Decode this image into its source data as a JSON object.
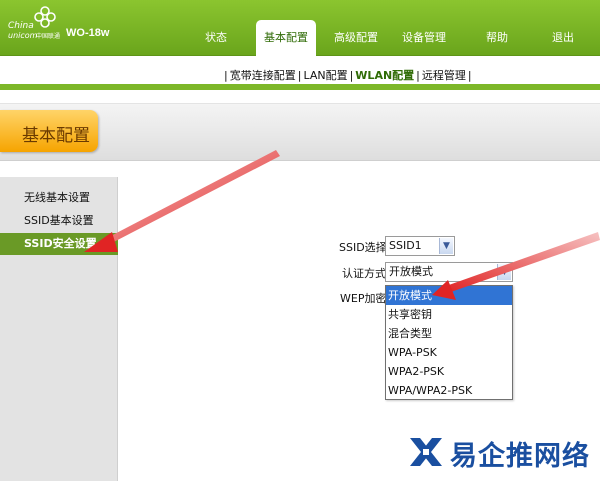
{
  "brand": {
    "logo_text_line1": "China",
    "logo_text_line2": "unicom",
    "logo_cn": "中国联通",
    "model": "WO-18w"
  },
  "nav": {
    "items": [
      {
        "label": "状态"
      },
      {
        "label": "基本配置",
        "active": true
      },
      {
        "label": "高级配置"
      },
      {
        "label": "设备管理"
      },
      {
        "label": "帮助"
      },
      {
        "label": "退出"
      }
    ]
  },
  "subnav": {
    "items": [
      "宽带连接配置",
      "LAN配置",
      "WLAN配置",
      "远程管理"
    ],
    "current": "WLAN配置"
  },
  "banner": {
    "title": "基本配置"
  },
  "sidebar": {
    "items": [
      {
        "label": "无线基本设置"
      },
      {
        "label": "SSID基本设置"
      },
      {
        "label": "SSID安全设置",
        "active": true
      }
    ]
  },
  "form": {
    "ssid_label": "SSID选择",
    "ssid_value": "SSID1",
    "auth_label": "认证方式",
    "auth_value": "开放模式",
    "wep_label": "WEP加密"
  },
  "dropdown": {
    "options": [
      "开放模式",
      "共享密钥",
      "混合类型",
      "WPA-PSK",
      "WPA2-PSK",
      "WPA/WPA2-PSK"
    ],
    "selected_index": 0
  },
  "watermark": {
    "text": "易企推网络"
  },
  "colors": {
    "brand_green": "#7db729",
    "menu_active": "#6a9a26",
    "banner_orange": "#f6a400",
    "selection_blue": "#3074d4",
    "arrow_red": "#e03030"
  }
}
